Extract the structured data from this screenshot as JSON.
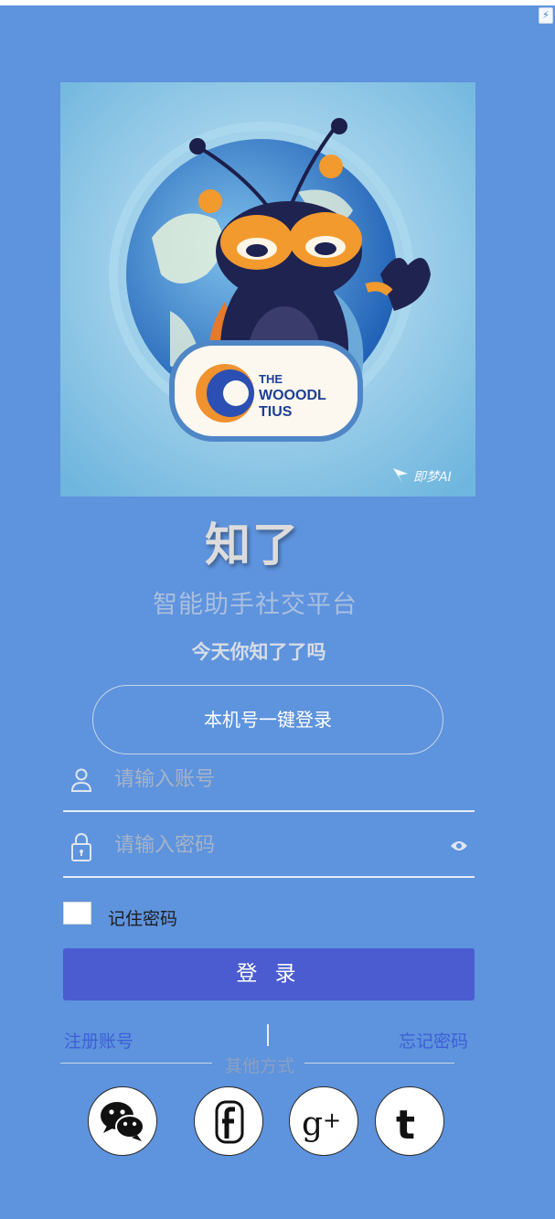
{
  "hero": {
    "badge_line1": "THE",
    "badge_line2": "WOOODL",
    "badge_line3": "TIUS",
    "watermark": "即梦AI"
  },
  "app": {
    "title": "知了",
    "subtitle": "智能助手社交平台",
    "slogan": "今天你知了了吗"
  },
  "quick_login_label": "本机号一键登录",
  "account_field": {
    "placeholder": "请输入账号",
    "icon": "user-icon"
  },
  "password_field": {
    "placeholder": "请输入密码",
    "icon": "lock-icon",
    "toggle_icon": "eye-icon"
  },
  "remember": {
    "label": "记住密码",
    "checked": false
  },
  "login_button_label": "登 录",
  "links": {
    "register": "注册账号",
    "forgot": "忘记密码"
  },
  "other_methods_label": "其他方式",
  "social_icons": [
    "wechat-icon",
    "facebook-icon",
    "google-plus-icon",
    "tumblr-icon"
  ],
  "colors": {
    "background": "#5e93dd",
    "login_button": "#4a5ccf",
    "link": "#3d5fd6"
  }
}
